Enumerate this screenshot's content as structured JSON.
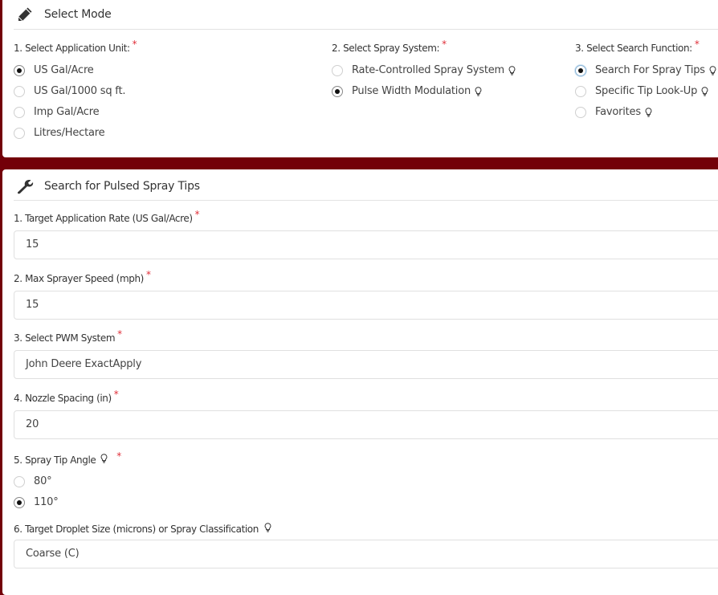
{
  "select_mode": {
    "title": "Select Mode",
    "application_unit": {
      "label": "1. Select Application Unit:",
      "required": "*",
      "options": [
        {
          "label": "US Gal/Acre",
          "checked": true
        },
        {
          "label": "US Gal/1000 sq ft.",
          "checked": false
        },
        {
          "label": "Imp Gal/Acre",
          "checked": false
        },
        {
          "label": "Litres/Hectare",
          "checked": false
        }
      ]
    },
    "spray_system": {
      "label": "2. Select Spray System:",
      "required": "*",
      "options": [
        {
          "label": "Rate-Controlled Spray System",
          "checked": false,
          "info": "lightbulb-icon"
        },
        {
          "label": "Pulse Width Modulation",
          "checked": true,
          "info": "lightbulb-icon"
        }
      ]
    },
    "search_function": {
      "label": "3. Select Search Function:",
      "required": "*",
      "options": [
        {
          "label": "Search For Spray Tips",
          "checked": true,
          "info": "lightbulb-icon"
        },
        {
          "label": "Specific Tip Look-Up",
          "checked": false,
          "info": "lightbulb-icon"
        },
        {
          "label": "Favorites",
          "checked": false,
          "info": "lightbulb-icon"
        }
      ]
    }
  },
  "search_pulsed": {
    "title": "Search for Pulsed Spray Tips",
    "fields": {
      "application_rate": {
        "label": "1. Target Application Rate (US Gal/Acre)",
        "required": "*",
        "value": "15"
      },
      "max_speed": {
        "label": "2. Max Sprayer Speed (mph)",
        "required": "*",
        "value": "15"
      },
      "pwm_system": {
        "label": "3. Select PWM System",
        "required": "*",
        "value": "John Deere ExactApply"
      },
      "nozzle_spacing": {
        "label": "4. Nozzle Spacing (in)",
        "required": "*",
        "value": "20"
      },
      "tip_angle": {
        "label": "5. Spray Tip Angle",
        "required": "*",
        "options": [
          {
            "label": "80°",
            "checked": false
          },
          {
            "label": "110°",
            "checked": true
          }
        ]
      },
      "droplet_size": {
        "label": "6. Target Droplet Size (microns) or Spray Classification",
        "value": "Coarse (C)"
      }
    }
  },
  "colors": {
    "brand": "#730008",
    "required": "#e0303a"
  }
}
